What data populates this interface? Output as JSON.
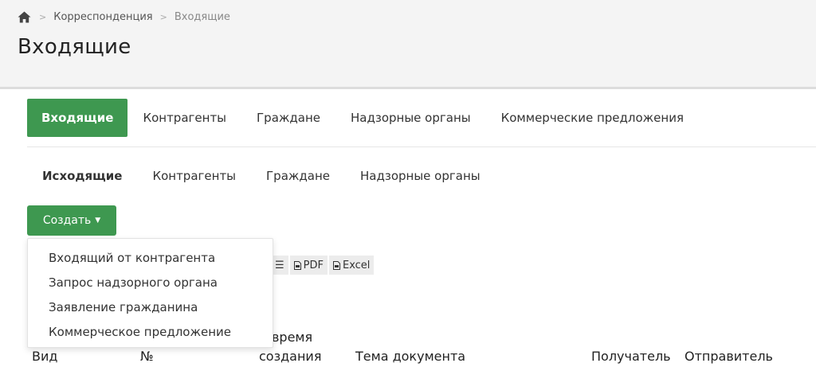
{
  "breadcrumb": {
    "items": [
      "Корреспонденция",
      "Входящие"
    ]
  },
  "page_title": "Входящие",
  "tabs": [
    {
      "label": "Входящие"
    },
    {
      "label": "Контрагенты"
    },
    {
      "label": "Граждане"
    },
    {
      "label": "Надзорные органы"
    },
    {
      "label": "Коммерческие предложения"
    }
  ],
  "subtabs": [
    {
      "label": "Исходящие"
    },
    {
      "label": "Контрагенты"
    },
    {
      "label": "Граждане"
    },
    {
      "label": "Надзорные органы"
    }
  ],
  "create_button": {
    "label": "Создать"
  },
  "create_menu": [
    {
      "label": "Входящий от контрагента"
    },
    {
      "label": "Запрос надзорного органа"
    },
    {
      "label": "Заявление гражданина"
    },
    {
      "label": "Коммерческое предложение"
    }
  ],
  "export": {
    "list_glyph": "☰",
    "pdf_label": "PDF",
    "excel_label": "Excel"
  },
  "table": {
    "columns": {
      "kind": "Вид",
      "number": "№",
      "time_part1": "время",
      "time_part2": "создания",
      "topic": "Тема документа",
      "recipient": "Получатель",
      "sender": "Отправитель"
    }
  },
  "colors": {
    "accent": "#3e9850",
    "header_bg": "#f4f4f4"
  }
}
